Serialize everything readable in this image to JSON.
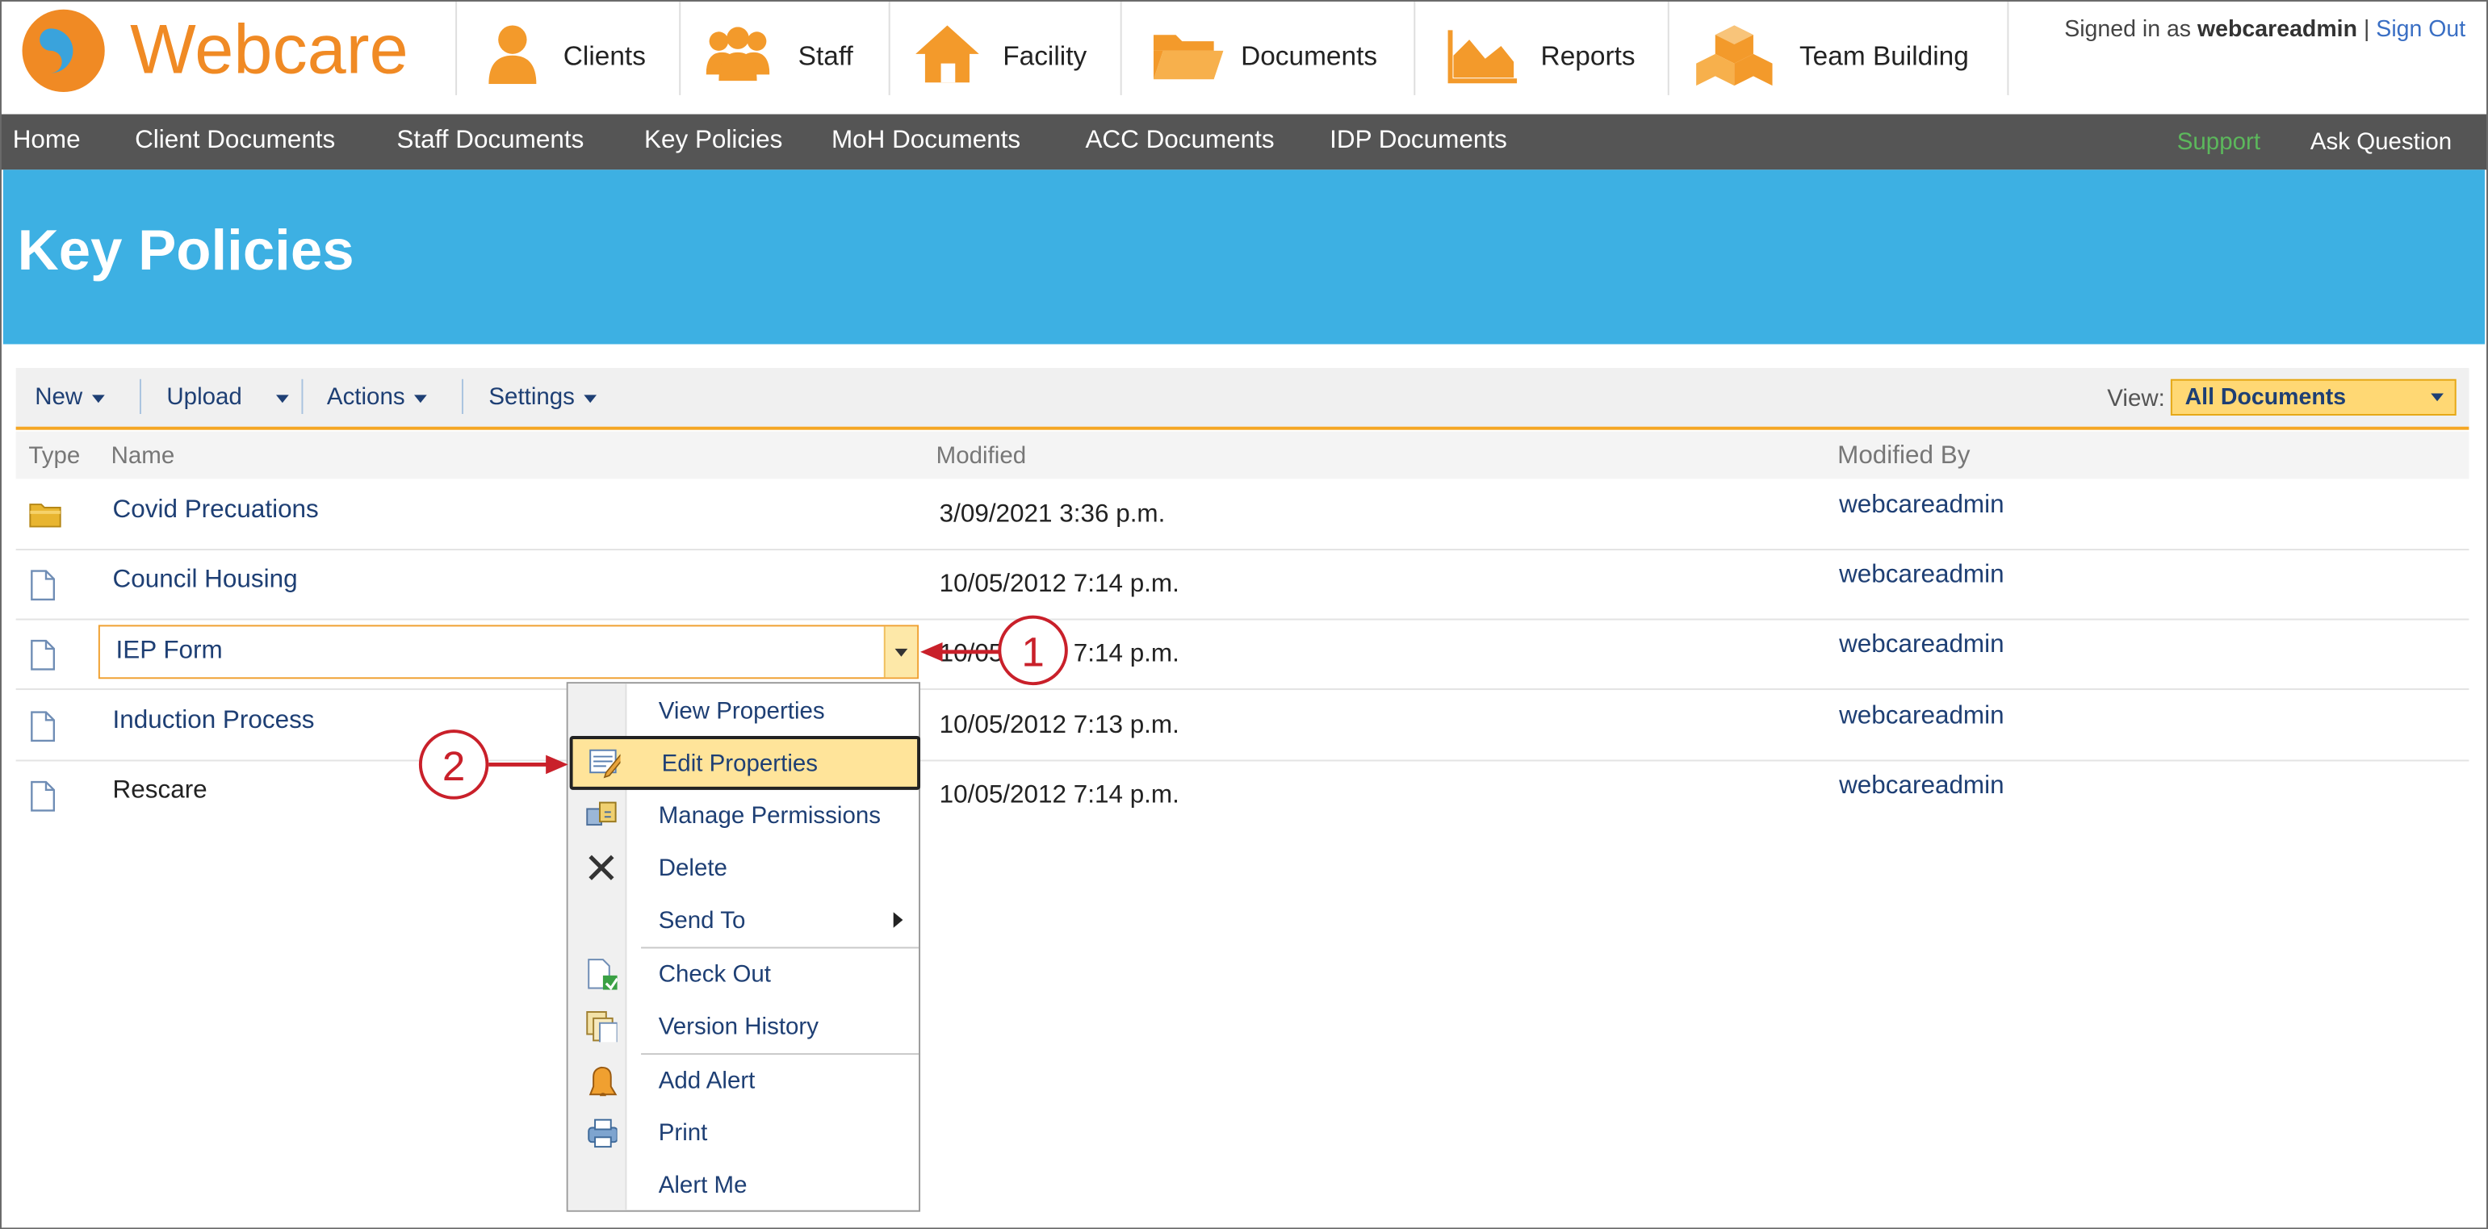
{
  "app": {
    "logo_text": "Webcare"
  },
  "top_nav": [
    {
      "label": "Clients",
      "icon": "person-icon"
    },
    {
      "label": "Staff",
      "icon": "group-icon"
    },
    {
      "label": "Facility",
      "icon": "house-icon"
    },
    {
      "label": "Documents",
      "icon": "folder-icon"
    },
    {
      "label": "Reports",
      "icon": "chart-icon"
    },
    {
      "label": "Team Building",
      "icon": "boxes-icon"
    }
  ],
  "account": {
    "signed_in_as": "Signed in as",
    "user": "webcareadmin",
    "divider": "|",
    "sign_out": "Sign Out"
  },
  "sub_nav": [
    "Home",
    "Client Documents",
    "Staff Documents",
    "Key Policies",
    "MoH Documents",
    "ACC Documents",
    "IDP Documents"
  ],
  "sub_nav_right": {
    "support": "Support",
    "ask": "Ask Question"
  },
  "page": {
    "title": "Key Policies"
  },
  "toolbar": {
    "new": "New",
    "upload": "Upload",
    "actions": "Actions",
    "settings": "Settings",
    "view_label": "View:",
    "view_value": "All Documents"
  },
  "columns": {
    "type": "Type",
    "name": "Name",
    "modified": "Modified",
    "modified_by": "Modified By"
  },
  "rows": [
    {
      "name": "Covid Precuations",
      "modified": "3/09/2021 3:36 p.m.",
      "by": "webcareadmin",
      "type": "folder"
    },
    {
      "name": "Council Housing",
      "modified": "10/05/2012 7:14 p.m.",
      "by": "webcareadmin",
      "type": "document"
    },
    {
      "name": "IEP Form",
      "modified": "10/05/2012 7:14 p.m.",
      "by": "webcareadmin",
      "type": "document"
    },
    {
      "name": "Induction Process",
      "modified": "10/05/2012 7:13 p.m.",
      "by": "webcareadmin",
      "type": "document"
    },
    {
      "name": "Rescare",
      "modified": "10/05/2012 7:14 p.m.",
      "by": "webcareadmin",
      "type": "document"
    }
  ],
  "context_menu": [
    {
      "label": "View Properties"
    },
    {
      "label": "Edit Properties",
      "highlighted": true
    },
    {
      "label": "Manage Permissions"
    },
    {
      "label": "Delete"
    },
    {
      "label": "Send To"
    },
    {
      "label": "Check Out"
    },
    {
      "label": "Version History"
    },
    {
      "label": "Add Alert"
    },
    {
      "label": "Print"
    },
    {
      "label": "Alert Me"
    }
  ],
  "callouts": [
    "1",
    "2"
  ],
  "colors": {
    "accent_orange": "#f08a24",
    "banner_blue": "#3db0e3",
    "nav_dark": "#555555",
    "link_blue": "#1e3f74",
    "callout_red": "#c9202a"
  }
}
